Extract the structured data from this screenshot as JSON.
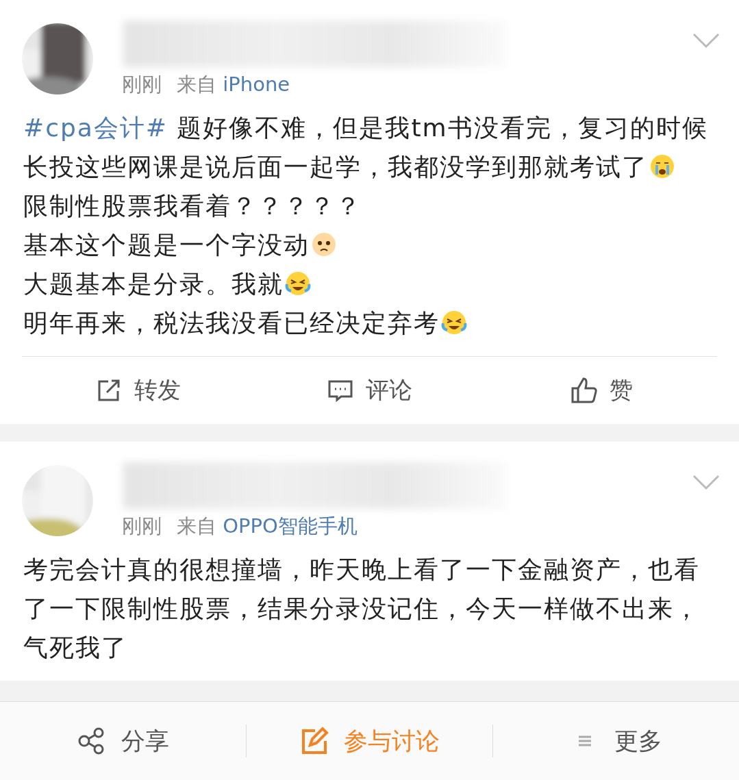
{
  "posts": [
    {
      "time": "刚刚",
      "source_prefix": "来自",
      "source": "iPhone",
      "paragraphs": [
        {
          "segments": [
            {
              "kind": "tag",
              "text": "#cpa会计#"
            },
            {
              "kind": "text",
              "text": " 题好像不难，但是我tm书没看完，复习的时候长投这些网课是说后面一起学，我都没学到那就考试了"
            },
            {
              "kind": "crying"
            }
          ]
        },
        {
          "segments": [
            {
              "kind": "text",
              "text": "限制性股票我看着？？？？？"
            }
          ]
        },
        {
          "segments": [
            {
              "kind": "text",
              "text": "基本这个题是一个字没动"
            },
            {
              "kind": "sad"
            }
          ]
        },
        {
          "segments": [
            {
              "kind": "text",
              "text": "大题基本是分录。我就"
            },
            {
              "kind": "sobbing"
            }
          ]
        },
        {
          "segments": [
            {
              "kind": "text",
              "text": "明年再来，税法我没看已经决定弃考"
            },
            {
              "kind": "sobbing"
            }
          ]
        }
      ],
      "actions": [
        {
          "label": "转发"
        },
        {
          "label": "评论"
        },
        {
          "label": "赞"
        }
      ]
    },
    {
      "time": "刚刚",
      "source_prefix": "来自",
      "source": "OPPO智能手机",
      "paragraphs": [
        {
          "segments": [
            {
              "kind": "text",
              "text": "考完会计真的很想撞墙，昨天晚上看了一下金融资产，也看了一下限制性股票，结果分录没记住，今天一样做不出来，气死我了"
            }
          ]
        }
      ]
    }
  ],
  "bottom_bar": [
    {
      "label": "分享",
      "highlighted": false
    },
    {
      "label": "参与讨论",
      "highlighted": true
    },
    {
      "label": "更多",
      "highlighted": false
    }
  ]
}
